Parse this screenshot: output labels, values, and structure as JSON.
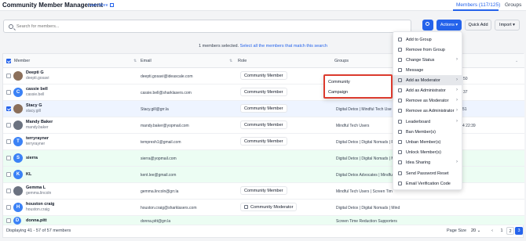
{
  "header": {
    "title": "Community Member Management",
    "learn_more": "Learn More",
    "tabs": [
      {
        "label": "Members (117/125)",
        "active": true
      },
      {
        "label": "Groups",
        "active": false
      }
    ]
  },
  "search": {
    "placeholder": "Search for members..."
  },
  "toolbar": {
    "actions_label": "Actions",
    "quick_add_label": "Quick Add",
    "import_label": "Import"
  },
  "selection": {
    "text": "1 members selected.",
    "link": "Select all the members that match this search"
  },
  "table": {
    "columns": [
      "Member",
      "Email",
      "Role",
      "Groups"
    ],
    "rows": [
      {
        "name": "Deepti G",
        "username": "deepti.gosavi",
        "email": "deepti.gosavi@ideascale.com",
        "role": "Community Member",
        "groups": "",
        "extra": "",
        "avatar": "img",
        "checked": false
      },
      {
        "name": "cassie bell",
        "username": "cassie.bell",
        "email": "cassie.bell@sharklasers.com",
        "role": "Community Member",
        "groups": "",
        "extra": "",
        "avatar": "C",
        "checked": false
      },
      {
        "name": "Stacy G",
        "username": "stacy.gill",
        "email": "Stacy.gill@grr.la",
        "role": "Community Member",
        "groups": "Digital Detox | Mindful Tech Use",
        "extra": "51",
        "avatar": "img",
        "checked": true
      },
      {
        "name": "Mandy Baker",
        "username": "mandy.baker",
        "email": "mandy.baker@yopmail.com",
        "role": "Community Member",
        "groups": "Mindful Tech Users",
        "extra": "4 22:39",
        "avatar": "img2",
        "checked": false
      },
      {
        "name": "terryrayner",
        "username": "terryrayner",
        "email": "tempresh1@gmail.com",
        "role": "Community Member",
        "groups": "Digital Detox | Digital Nomads | Rem",
        "extra": "",
        "avatar": "T",
        "checked": false
      },
      {
        "name": "sierra",
        "username": "",
        "email": "sierra@yopmail.com",
        "role": "",
        "groups": "Digital Detox | Digital Nomads | Mind",
        "extra": "",
        "avatar": "S",
        "checked": false
      },
      {
        "name": "KL",
        "username": "",
        "email": "kent.lee@gmail.com",
        "role": "",
        "groups": "Digital Detox Advocates | Mindful Te",
        "extra": "",
        "avatar": "K",
        "checked": false
      },
      {
        "name": "Gemma L",
        "username": "gemma.lincoln",
        "email": "gemma.lincoln@grr.la",
        "role": "Community Member",
        "groups": "Mindful Tech Users | Screen Tim",
        "extra": "",
        "avatar": "img2",
        "checked": false
      },
      {
        "name": "houston craig",
        "username": "houston.craig",
        "email": "houston.craig@sharklasers.com",
        "role": "Community Moderator",
        "groups": "Digital Detox | Digital Nomads | Mind",
        "extra": "",
        "avatar": "H",
        "checked": false
      },
      {
        "name": "donna.pitt",
        "username": "",
        "email": "donna.pitt@grr.la",
        "role": "",
        "groups": "Screen Time Reduction Supporters",
        "extra": "",
        "avatar": "D",
        "checked": false
      }
    ]
  },
  "menu": {
    "items": [
      {
        "label": "Add to Group",
        "chevron": false
      },
      {
        "label": "Remove from Group",
        "chevron": false
      },
      {
        "label": "Change Status",
        "chevron": true
      },
      {
        "label": "Message",
        "chevron": false
      },
      {
        "label": "Add as Moderator",
        "chevron": true
      },
      {
        "label": "Add as Administrator",
        "chevron": true
      },
      {
        "label": "Remove as Moderator",
        "chevron": true
      },
      {
        "label": "Remove as Administrator",
        "chevron": true
      },
      {
        "label": "Leaderboard",
        "chevron": true
      },
      {
        "label": "Ban Member(s)",
        "chevron": false
      },
      {
        "label": "Unban Member(s)",
        "chevron": false
      },
      {
        "label": "Unlock Member(s)",
        "chevron": false
      },
      {
        "label": "Idea Sharing",
        "chevron": true
      },
      {
        "label": "Send Password Reset",
        "chevron": false
      },
      {
        "label": "Email Verification Code",
        "chevron": false
      }
    ],
    "side_fragments": [
      "50",
      "37"
    ]
  },
  "submenu": {
    "items": [
      "Community",
      "Campaign"
    ]
  },
  "footer": {
    "display": "Displaying 41 - 57 of 57 members",
    "page_size_label": "Page Size",
    "page_size_value": "20",
    "pages": [
      "1",
      "2",
      "3"
    ],
    "active_page": "3"
  }
}
